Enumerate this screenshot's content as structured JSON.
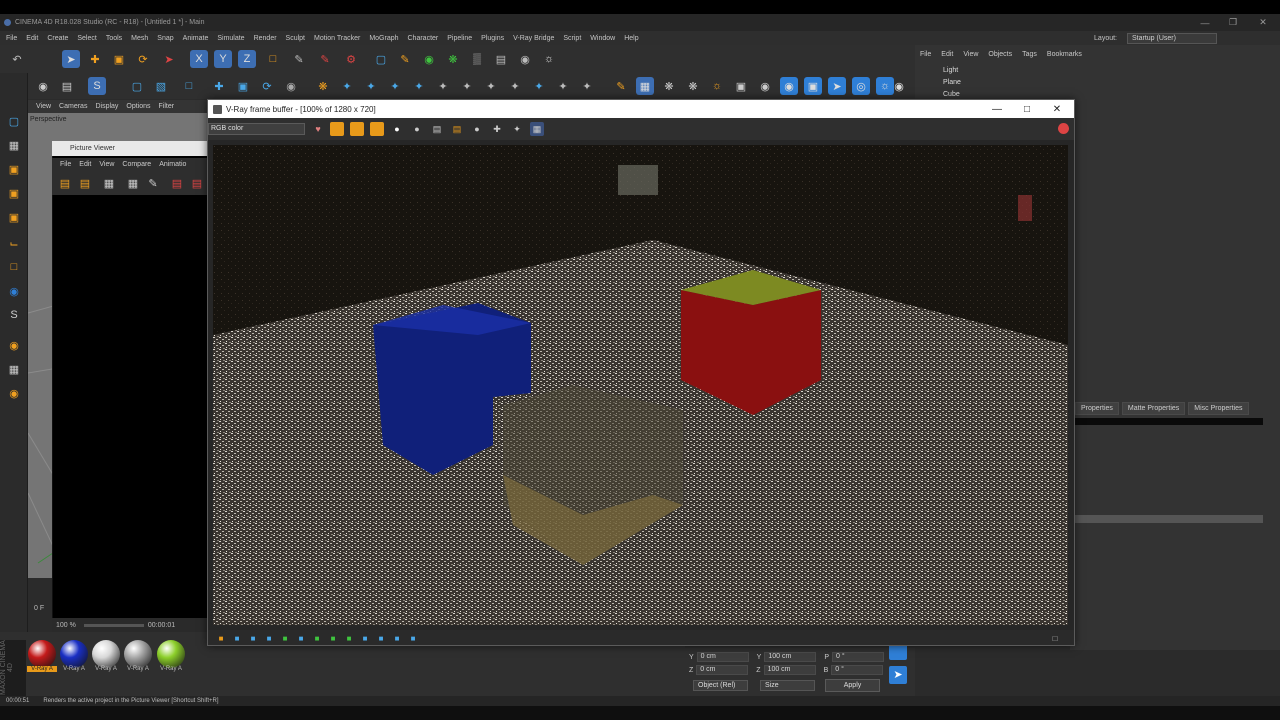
{
  "app": {
    "title": "CINEMA 4D R18.028 Studio (RC - R18) - [Untitled 1 *] - Main",
    "layout_label": "Layout:",
    "layout_value": "Startup (User)"
  },
  "menu": [
    "File",
    "Edit",
    "Create",
    "Select",
    "Tools",
    "Mesh",
    "Snap",
    "Animate",
    "Simulate",
    "Render",
    "Sculpt",
    "Motion Tracker",
    "MoGraph",
    "Character",
    "Pipeline",
    "Plugins",
    "V-Ray Bridge",
    "Script",
    "Window",
    "Help"
  ],
  "viewport": {
    "menu": [
      "View",
      "Cameras",
      "Display",
      "Options",
      "Filter"
    ],
    "label": "Perspective"
  },
  "picture_viewer": {
    "title": "Picture Viewer",
    "menu": [
      "File",
      "Edit",
      "View",
      "Compare",
      "Animatio"
    ],
    "zoom": "100 %",
    "time": "00:00:01",
    "frame": "0 F"
  },
  "object_manager": {
    "menu": [
      "File",
      "Edit",
      "View",
      "Objects",
      "Tags",
      "Bookmarks"
    ],
    "objects": [
      "Light",
      "Plane",
      "Cube"
    ]
  },
  "attributes": {
    "tabs": [
      "Properties",
      "Matte Properties",
      "Misc Properties"
    ]
  },
  "coords": {
    "rows": [
      {
        "a": "Y",
        "pos": "0 cm",
        "b": "Y",
        "size": "100 cm",
        "c": "P",
        "rot": "0 °"
      },
      {
        "a": "Z",
        "pos": "0 cm",
        "b": "Z",
        "size": "100 cm",
        "c": "B",
        "rot": "0 °"
      }
    ],
    "object_rel": "Object (Rel)",
    "size_mode": "Size",
    "apply": "Apply"
  },
  "materials": [
    {
      "label": "V-Ray A",
      "color": "#c41a1a"
    },
    {
      "label": "V-Ray A",
      "color": "#1a2fc4"
    },
    {
      "label": "V-Ray A",
      "color": "#d8d8d8"
    },
    {
      "label": "V-Ray A",
      "color": "#a8a8a8"
    },
    {
      "label": "V-Ray A",
      "color": "#8ccf2a"
    }
  ],
  "status": {
    "time": "00:00:51",
    "message": "Renders the active project in the Picture Viewer [Shortcut Shift+R]"
  },
  "vfb": {
    "title": "V-Ray frame buffer - [100% of 1280 x 720]",
    "channel": "RGB color"
  },
  "colors": {
    "accent_blue": "#2f7fd6",
    "accent_orange": "#e89a1a"
  }
}
